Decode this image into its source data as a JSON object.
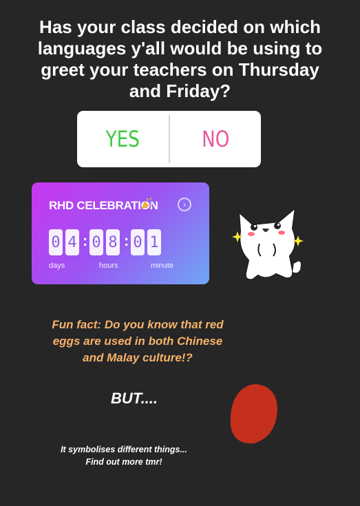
{
  "question": {
    "line1": "Has your class decided on which",
    "line2": "languages y'all would be using to",
    "line3": "greet your teachers on Thursday",
    "line4": "and Friday?"
  },
  "poll": {
    "yes_label": "YES",
    "no_label": "NO",
    "yes_color": "#3ccc3c",
    "no_color": "#e8579a"
  },
  "countdown": {
    "title": "RHD CELEBRATION",
    "title_icon": "party-popper-icon",
    "action_icon": "chevron-right-icon",
    "digits": [
      "0",
      "4",
      "0",
      "8",
      "0",
      "1"
    ],
    "separator": ":",
    "units": {
      "days": "days",
      "hours": "hours",
      "minutes": "minute"
    },
    "gradient_colors": [
      "#c837f0",
      "#9b55f2",
      "#6ea8f5"
    ]
  },
  "fun_fact": {
    "line1": "Fun fact: Do you know that red",
    "line2": "eggs are used in both Chinese",
    "line3": "and Malay culture!?"
  },
  "but_text": "BUT....",
  "symbolises": {
    "line1": "It symbolises different things...",
    "line2": "Find out more tmr!"
  },
  "stickers": {
    "egg_color": "#c4301c",
    "mascot_icon": "cat-sticker-icon"
  }
}
